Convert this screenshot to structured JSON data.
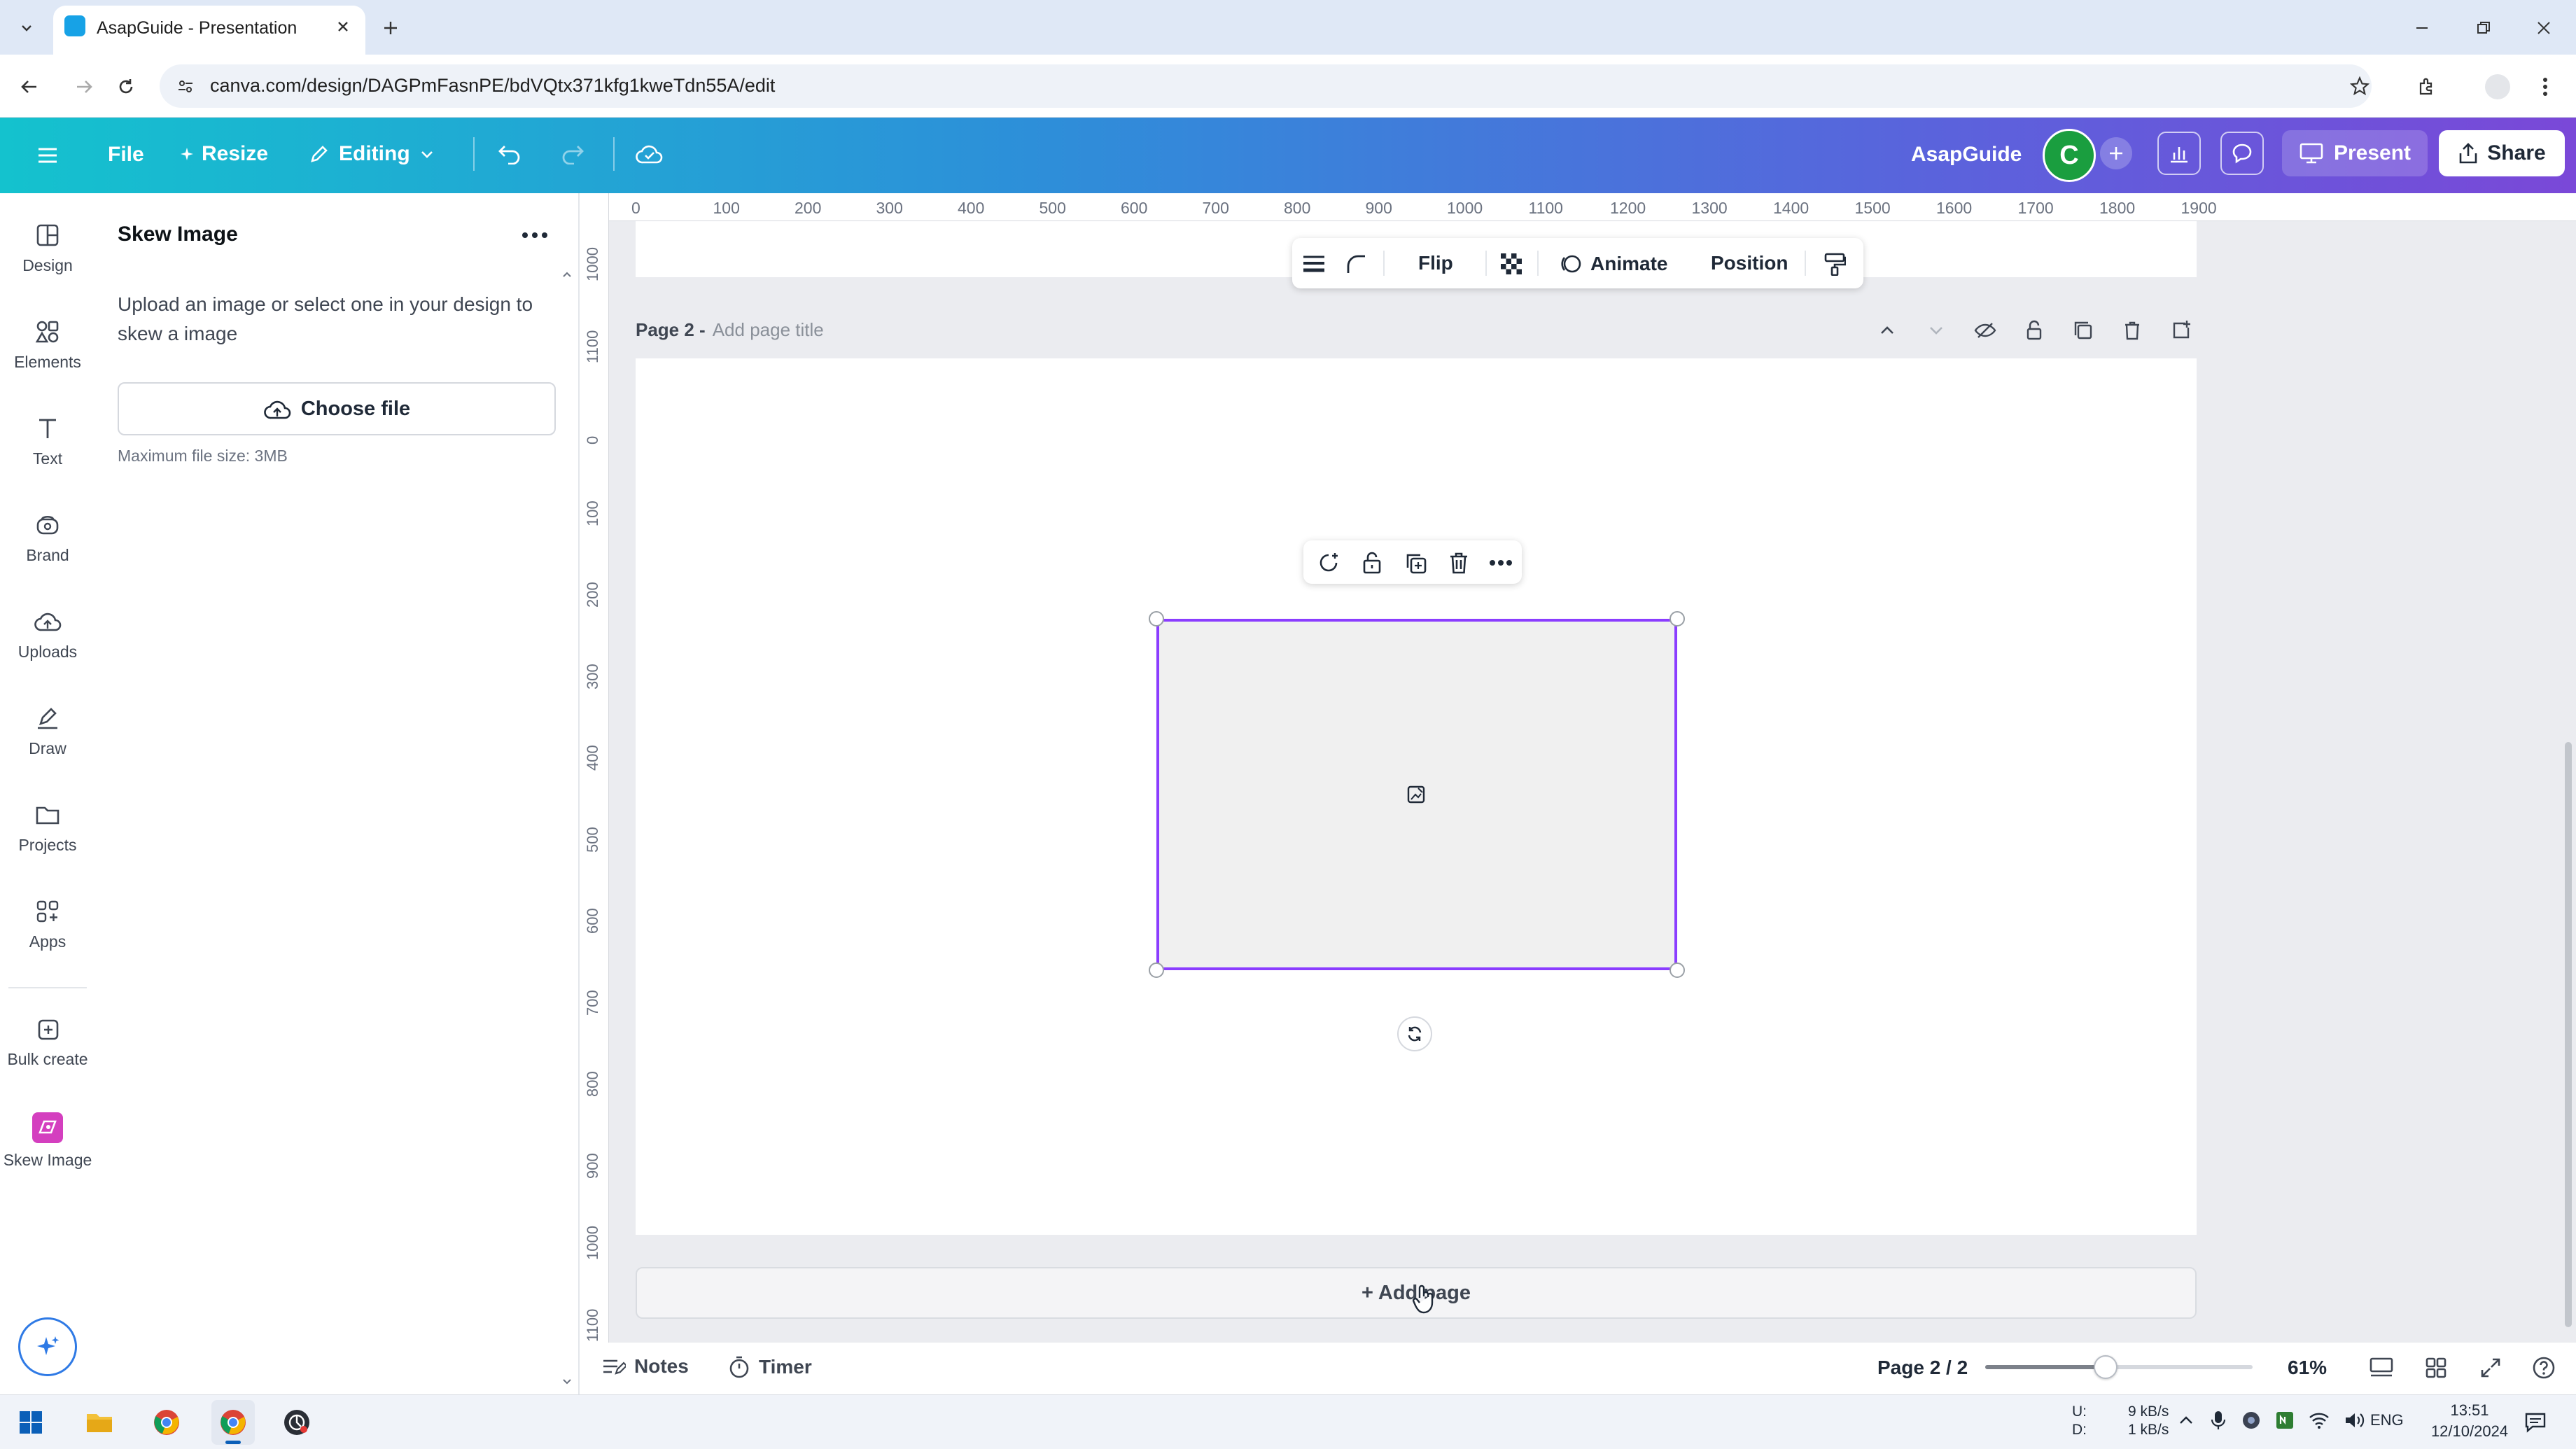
{
  "browser": {
    "tab_title": "AsapGuide - Presentation",
    "url": "canva.com/design/DAGPmFasnPE/bdVQtx371kfg1kweTdn55A/edit"
  },
  "header": {
    "menu": "File",
    "resize": "Resize",
    "editing": "Editing",
    "team_name": "AsapGuide",
    "avatar_letter": "C",
    "present": "Present",
    "share": "Share"
  },
  "rail": [
    {
      "label": "Design",
      "icon": "design-icon"
    },
    {
      "label": "Elements",
      "icon": "elements-icon"
    },
    {
      "label": "Text",
      "icon": "text-icon"
    },
    {
      "label": "Brand",
      "icon": "brand-icon"
    },
    {
      "label": "Uploads",
      "icon": "uploads-icon"
    },
    {
      "label": "Draw",
      "icon": "draw-icon"
    },
    {
      "label": "Projects",
      "icon": "projects-icon"
    },
    {
      "label": "Apps",
      "icon": "apps-icon"
    },
    {
      "label": "Bulk create",
      "icon": "bulk-create-icon"
    },
    {
      "label": "Skew Image",
      "icon": "skew-image-icon"
    }
  ],
  "panel": {
    "title": "Skew Image",
    "description": "Upload an image or select one in your design to skew a image",
    "choose_file": "Choose file",
    "max_size": "Maximum file size: 3MB"
  },
  "ruler": {
    "top": [
      "0",
      "100",
      "200",
      "300",
      "400",
      "500",
      "600",
      "700",
      "800",
      "900",
      "1000",
      "1100",
      "1200",
      "1300",
      "1400",
      "1500",
      "1600",
      "1700",
      "1800",
      "1900"
    ],
    "left": [
      "1000",
      "1100",
      "0",
      "100",
      "200",
      "300",
      "400",
      "500",
      "600",
      "700",
      "800",
      "900",
      "1000",
      "1100"
    ]
  },
  "context_toolbar": {
    "flip": "Flip",
    "animate": "Animate",
    "position": "Position"
  },
  "page": {
    "label": "Page 2 -",
    "title_placeholder": "Add page title",
    "add_page": "+ Add page"
  },
  "footer": {
    "notes": "Notes",
    "timer": "Timer",
    "page_indicator": "Page 2 / 2",
    "zoom": "61%",
    "zoom_fraction": 0.45
  },
  "taskbar": {
    "net_up_label": "U:",
    "net_down_label": "D:",
    "net_up": "9 kB/s",
    "net_down": "1 kB/s",
    "lang": "ENG",
    "time": "13:51",
    "date": "12/10/2024"
  },
  "colors": {
    "accent": "#8b3dff",
    "avatar": "#1a9e3f",
    "header_start": "#14c2ce",
    "header_end": "#7a48d8"
  }
}
